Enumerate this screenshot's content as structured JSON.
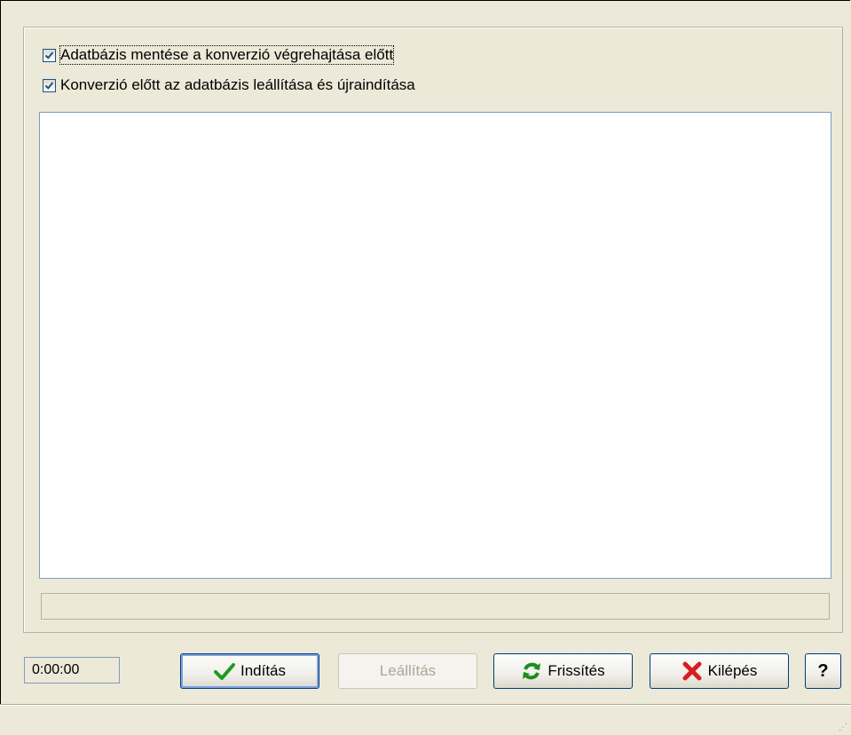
{
  "options": {
    "backup_before_conversion": {
      "label": "Adatbázis mentése a konverzió végrehajtása előtt",
      "checked": true
    },
    "restart_before_conversion": {
      "label": "Konverzió előtt az adatbázis leállítása és újraindítása",
      "checked": true
    }
  },
  "log": {
    "text": ""
  },
  "progress": {
    "value": 0
  },
  "timer": {
    "elapsed": "0:00:00"
  },
  "buttons": {
    "start": {
      "label": "Indítás",
      "icon": "checkmark-icon",
      "enabled": true
    },
    "stop": {
      "label": "Leállítás",
      "enabled": false
    },
    "refresh": {
      "label": "Frissítés",
      "icon": "refresh-icon",
      "enabled": true
    },
    "exit": {
      "label": "Kilépés",
      "icon": "close-x-icon",
      "enabled": true
    },
    "help": {
      "label": "?",
      "enabled": true
    }
  },
  "colors": {
    "accent": "#2fb432",
    "exit_icon": "#d81e1e",
    "check": "#1c5180",
    "window_bg": "#ece9d8"
  }
}
